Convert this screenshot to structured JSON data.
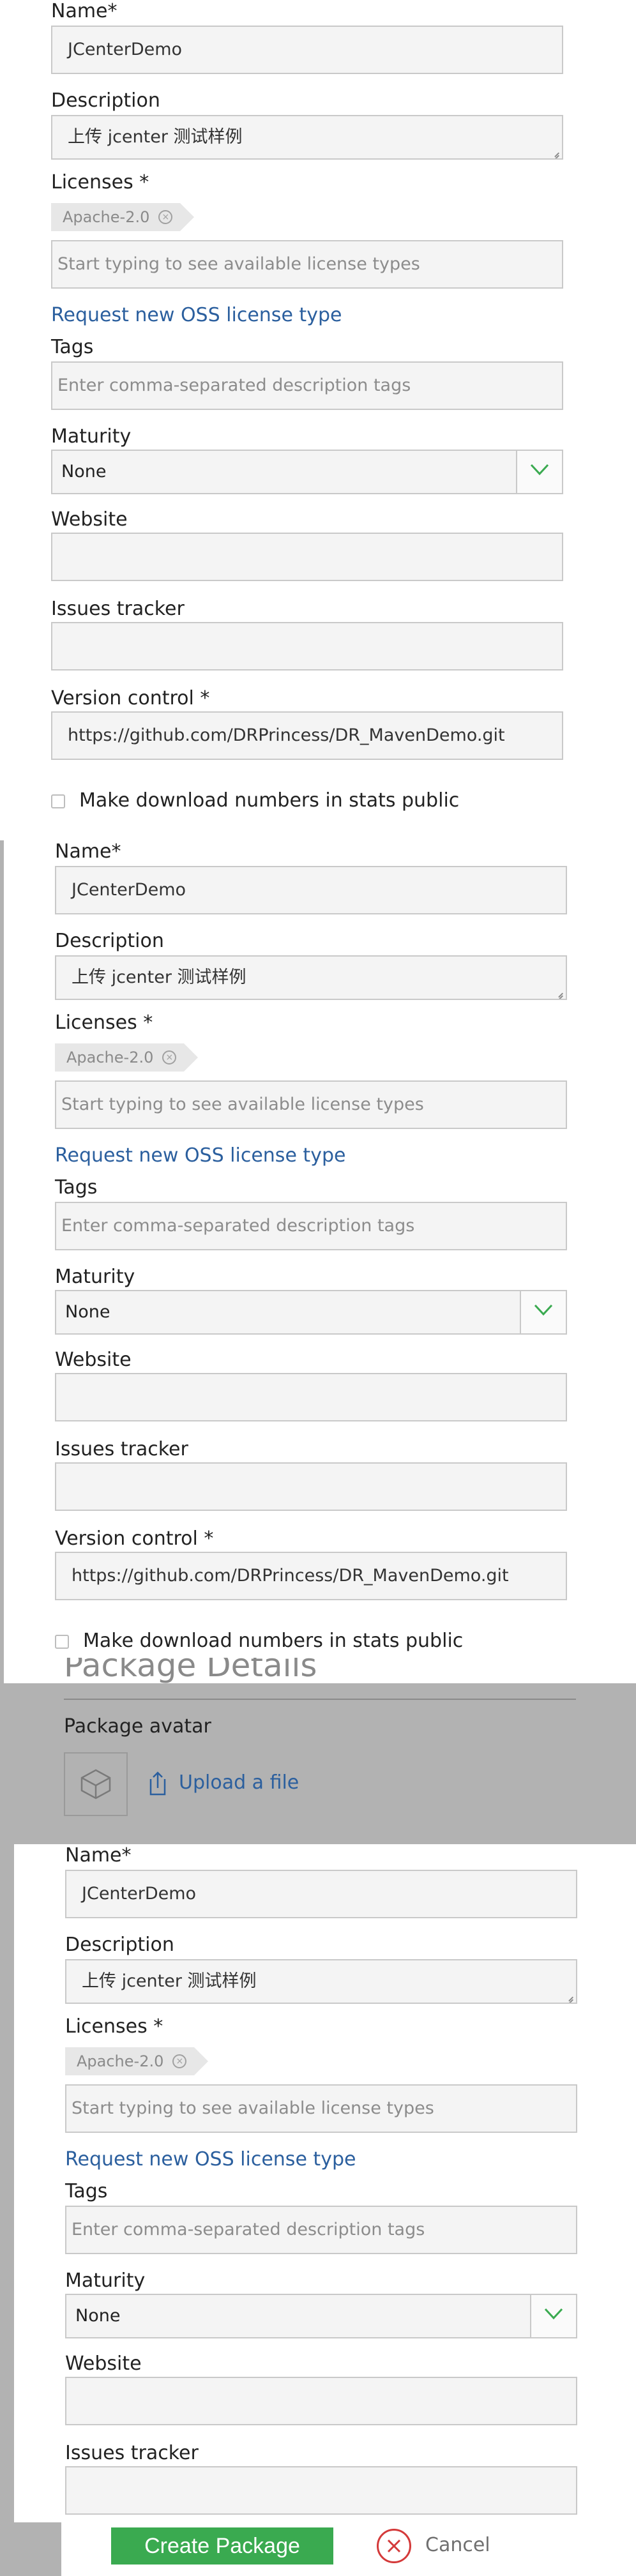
{
  "form": {
    "name_label": "Name*",
    "name_value": "JCenterDemo",
    "description_label": "Description",
    "description_value": "上传 jcenter 测试样例",
    "licenses_label": "Licenses *",
    "license_tag": "Apache-2.0",
    "license_placeholder": "Start typing to see available license types",
    "request_license_link": "Request new OSS license type",
    "tags_label": "Tags",
    "tags_placeholder": "Enter comma-separated description tags",
    "maturity_label": "Maturity",
    "maturity_value": "None",
    "website_label": "Website",
    "website_value": "",
    "issues_label": "Issues tracker",
    "issues_value": "",
    "vcs_label": "Version control *",
    "vcs_value": "https://github.com/DRPrincess/DR_MavenDemo.git",
    "stats_checkbox_label": "Make download numbers in stats public"
  },
  "package_details": {
    "heading": "Package Details",
    "avatar_label": "Package avatar",
    "upload_link": "Upload a file"
  },
  "actions": {
    "create_label": "Create Package",
    "cancel_label": "Cancel"
  },
  "colors": {
    "link": "#2b5f9e",
    "primary_button": "#3aaa50",
    "cancel_icon": "#d43a3a",
    "chevron": "#3aaa50"
  }
}
